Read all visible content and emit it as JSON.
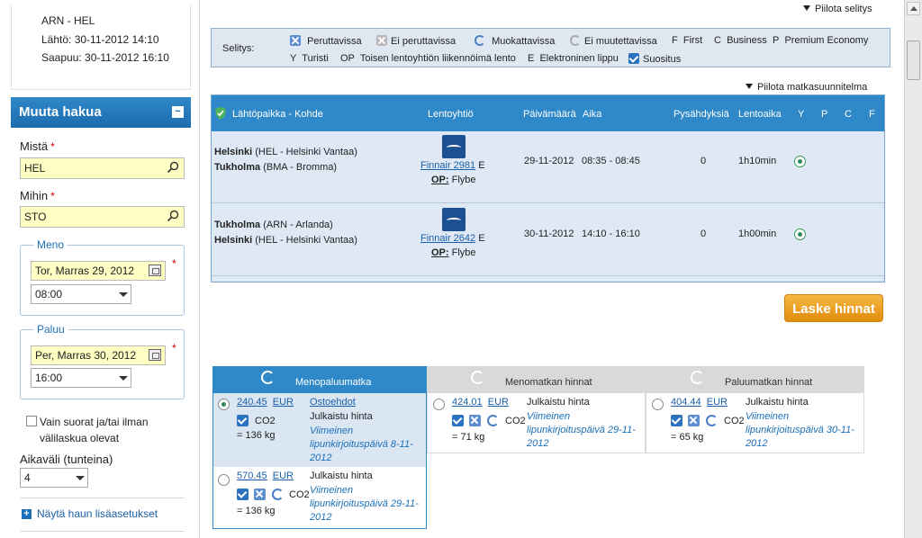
{
  "trip": {
    "route": "ARN - HEL",
    "departure": "Lähtö: 30-11-2012 14:10",
    "arrival": "Saapuu: 30-11-2012 16:10"
  },
  "search": {
    "title": "Muuta hakua",
    "from_label": "Mistä",
    "from_value": "HEL",
    "to_label": "Mihin",
    "to_value": "STO",
    "outbound_legend": "Meno",
    "outbound_date": "Tor, Marras 29, 2012",
    "outbound_time": "08:00",
    "return_legend": "Paluu",
    "return_date": "Per, Marras 30, 2012",
    "return_time": "16:00",
    "direct_label": "Vain suorat ja/tai ilman välilaskua olevat",
    "window_label": "Aikaväli (tunteina)",
    "window_value": "4",
    "more_options": "Näytä haun lisäasetukset"
  },
  "legend": {
    "toggle": "Piilota selitys",
    "title": "Selitys:",
    "items": [
      "Peruttavissa",
      "Ei peruttavissa",
      "Muokattavissa",
      "Ei muutettavissa",
      "F",
      "First",
      "C",
      "Business",
      "P",
      "Premium Economy",
      "Y",
      "Turisti",
      "OP",
      "Toisen lentoyhtiön liikennöimä lento",
      "E",
      "Elektroninen lippu",
      "Suositus"
    ]
  },
  "plan": {
    "toggle": "Piilota matkasuunnitelma",
    "headers": [
      "Lähtöpaikka - Kohde",
      "Lentoyhtiö",
      "Päivämäärä",
      "Aika",
      "Pysähdyksiä",
      "Lentoaika",
      "Y",
      "P",
      "C",
      "F"
    ],
    "flights": [
      {
        "from_city": "Helsinki",
        "from_airport": "(HEL - Helsinki Vantaa)",
        "to_city": "Tukholma",
        "to_airport": "(BMA - Bromma)",
        "airline": "Finnair 2981",
        "ticket": "E",
        "op_label": "OP:",
        "operator": "Flybe",
        "date": "29-11-2012",
        "time": "08:35 - 08:45",
        "stops": "0",
        "duration": "1h10min"
      },
      {
        "from_city": "Tukholma",
        "from_airport": "(ARN - Arlanda)",
        "to_city": "Helsinki",
        "to_airport": "(HEL - Helsinki Vantaa)",
        "airline": "Finnair 2642",
        "ticket": "E",
        "op_label": "OP:",
        "operator": "Flybe",
        "date": "30-11-2012",
        "time": "14:10 - 16:10",
        "stops": "0",
        "duration": "1h00min"
      }
    ]
  },
  "calc_button": "Laske hinnat",
  "prices": {
    "tabs": [
      "Menopaluumatka",
      "Menomatkan hinnat",
      "Paluumatkan hinnat"
    ],
    "roundtrip": [
      {
        "price": "240.45",
        "currency": "EUR",
        "offer": "Ostoehdot",
        "fare": "Julkaistu hinta",
        "deadline": "Viimeinen lipunkirjoituspäivä 8-11-2012",
        "co2_label": "CO2",
        "co2": "= 136 kg"
      },
      {
        "price": "570.45",
        "currency": "EUR",
        "fare": "Julkaistu hinta",
        "deadline": "Viimeinen lipunkirjoituspäivä 29-11-2012",
        "co2_label": "CO2",
        "co2": "= 136 kg"
      }
    ],
    "outbound": {
      "price": "424.01",
      "currency": "EUR",
      "fare": "Julkaistu hinta",
      "deadline": "Viimeinen lipunkirjoituspäivä 29-11-2012",
      "co2_label": "CO2",
      "co2": "= 71 kg"
    },
    "return": {
      "price": "404.44",
      "currency": "EUR",
      "fare": "Julkaistu hinta",
      "deadline": "Viimeinen lipunkirjoituspäivä 30-11-2012",
      "co2_label": "CO2",
      "co2": "= 65 kg"
    }
  },
  "colors": {
    "accent": "#2f88c8",
    "button": "#f0a020",
    "highlight": "#ffffc4"
  }
}
